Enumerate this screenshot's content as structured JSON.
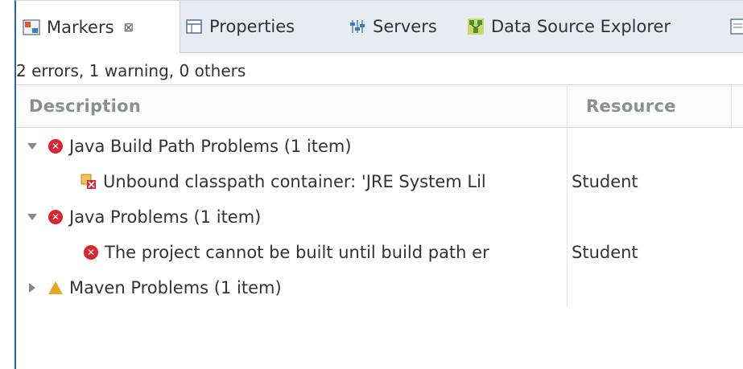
{
  "tabs": [
    {
      "label": "Markers",
      "icon": "markers-icon",
      "active": true,
      "close": "⊠"
    },
    {
      "label": "Properties",
      "icon": "properties-icon",
      "active": false
    },
    {
      "label": "Servers",
      "icon": "servers-icon",
      "active": false
    },
    {
      "label": "Data Source Explorer",
      "icon": "data-source-explorer-icon",
      "active": false
    }
  ],
  "summary": "2 errors, 1 warning, 0 others",
  "columns": {
    "description": "Description",
    "resource": "Resource"
  },
  "rows": [
    {
      "label": "Java Build Path Problems (1 item)",
      "resource": "",
      "level": 0,
      "expanded": true,
      "icon": "error-icon"
    },
    {
      "label": "Unbound classpath container: 'JRE System Lil",
      "resource": "Student",
      "level": 1,
      "icon": "classpath-error-icon"
    },
    {
      "label": "Java Problems (1 item)",
      "resource": "",
      "level": 0,
      "expanded": true,
      "icon": "error-icon"
    },
    {
      "label": "The project cannot be built until build path er",
      "resource": "Student",
      "level": 1,
      "icon": "error-icon"
    },
    {
      "label": "Maven Problems (1 item)",
      "resource": "",
      "level": 0,
      "expanded": false,
      "icon": "warning-icon"
    }
  ],
  "colors": {
    "error": "#d9262f",
    "warning": "#e6a823",
    "accent": "#2d62a8"
  }
}
